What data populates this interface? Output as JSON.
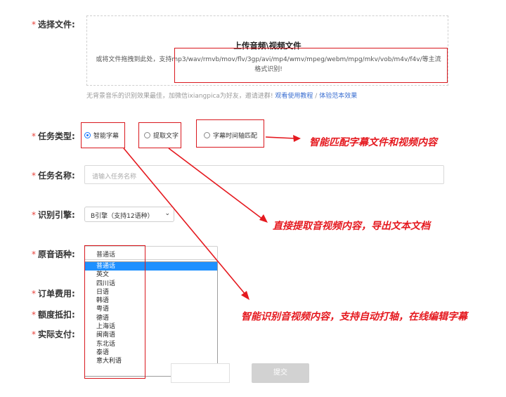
{
  "form": {
    "file_label": "选择文件:",
    "task_type_label": "任务类型:",
    "task_name_label": "任务名称:",
    "engine_label": "识别引擎:",
    "language_label": "原音语种:",
    "order_fee_label": "订单费用:",
    "quota_label": "额度抵扣:",
    "actual_pay_label": "实际支付:"
  },
  "upload": {
    "title": "上传音频\\视频文件",
    "desc": "或将文件拖拽到此处，支持mp3/wav/rmvb/mov/flv/3gp/avi/mp4/wmv/mpeg/webm/mpg/mkv/vob/m4v/f4v/等主流格式识别!",
    "hint": "无背景音乐的识别效果最佳，加微信ixiangpica为好友，邀请进群!",
    "link_tutorial": "观看使用教程",
    "link_separator": " / ",
    "link_sample": "体验范本效果"
  },
  "task_types": {
    "smart_subtitle": "智能字幕",
    "extract_text": "提取文字",
    "timeline_match": "字幕时间轴匹配"
  },
  "task_name": {
    "placeholder": "请输入任务名称"
  },
  "engine": {
    "selected": "B引擎（支持12语种）"
  },
  "language": {
    "selected": "普通话",
    "options": [
      "普通话",
      "英文",
      "四川话",
      "日语",
      "韩语",
      "粤语",
      "德语",
      "上海话",
      "闽南语",
      "东北话",
      "泰语",
      "意大利语"
    ]
  },
  "submit_label": "提交",
  "annotations": {
    "match": "智能匹配字幕文件和视频内容",
    "extract": "直接提取音视频内容，导出文本文档",
    "smart": "智能识别音视频内容，支持自动打轴，在线编辑字幕"
  },
  "colors": {
    "annotation_red": "#e5191f",
    "radio_blue": "#1677ff",
    "link_blue": "#3b6fd1"
  }
}
